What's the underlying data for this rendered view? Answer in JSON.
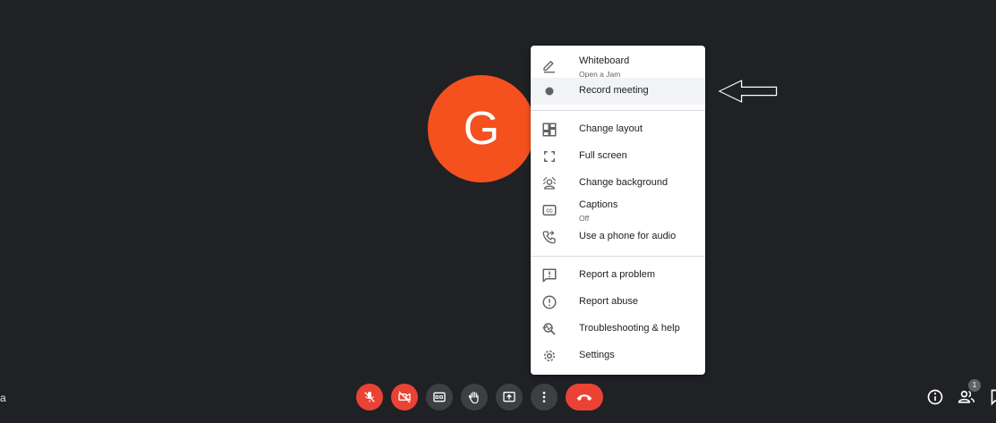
{
  "avatar": {
    "initial": "G",
    "color": "#f4511e"
  },
  "menu": {
    "items": [
      {
        "label": "Whiteboard",
        "sub": "Open a Jam",
        "icon": "pencil-icon"
      },
      {
        "label": "Record meeting",
        "icon": "record-icon",
        "highlighted": true
      },
      {
        "label": "Change layout",
        "icon": "layout-icon"
      },
      {
        "label": "Full screen",
        "icon": "fullscreen-icon"
      },
      {
        "label": "Change background",
        "icon": "background-icon"
      },
      {
        "label": "Captions",
        "sub": "Off",
        "icon": "captions-icon"
      },
      {
        "label": "Use a phone for audio",
        "icon": "phone-audio-icon"
      },
      {
        "label": "Report a problem",
        "icon": "feedback-icon"
      },
      {
        "label": "Report abuse",
        "icon": "alert-icon"
      },
      {
        "label": "Troubleshooting & help",
        "icon": "troubleshoot-icon"
      },
      {
        "label": "Settings",
        "icon": "settings-icon"
      }
    ]
  },
  "annotation": {
    "icon": "arrow-left-outline-icon"
  },
  "bottom_bar": {
    "left_text": "a",
    "controls": [
      "mic-off-icon",
      "camera-off-icon",
      "captions-icon",
      "raise-hand-icon",
      "present-icon",
      "more-options-icon",
      "end-call-icon"
    ],
    "right": {
      "info_icon": "info-icon",
      "people_icon": "people-icon",
      "people_count": "1",
      "chat_icon": "chat-icon"
    }
  },
  "colors": {
    "background": "#202124",
    "danger": "#ea4335",
    "control": "#3c4043"
  }
}
